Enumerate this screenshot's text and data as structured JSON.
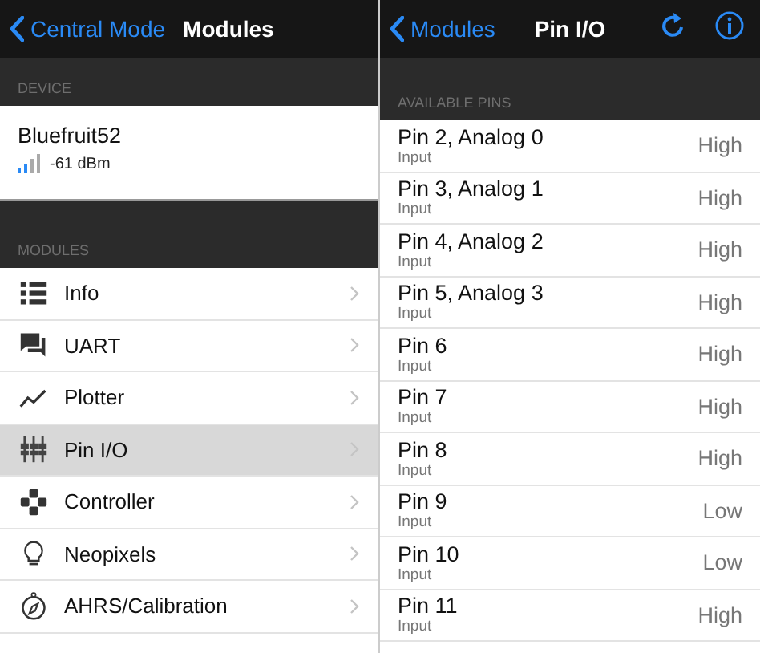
{
  "left": {
    "nav": {
      "back": "Central Mode",
      "title": "Modules"
    },
    "device_header": "DEVICE",
    "device": {
      "name": "Bluefruit52",
      "rssi": "-61 dBm"
    },
    "modules_header": "MODULES",
    "modules": [
      {
        "label": "Info",
        "selected": false
      },
      {
        "label": "UART",
        "selected": false
      },
      {
        "label": "Plotter",
        "selected": false
      },
      {
        "label": "Pin I/O",
        "selected": true
      },
      {
        "label": "Controller",
        "selected": false
      },
      {
        "label": "Neopixels",
        "selected": false
      },
      {
        "label": "AHRS/Calibration",
        "selected": false
      }
    ]
  },
  "right": {
    "nav": {
      "back": "Modules",
      "title": "Pin I/O"
    },
    "pins_header": "AVAILABLE PINS",
    "pins": [
      {
        "name": "Pin 2, Analog 0",
        "mode": "Input",
        "value": "High"
      },
      {
        "name": "Pin 3, Analog 1",
        "mode": "Input",
        "value": "High"
      },
      {
        "name": "Pin 4, Analog 2",
        "mode": "Input",
        "value": "High"
      },
      {
        "name": "Pin 5, Analog 3",
        "mode": "Input",
        "value": "High"
      },
      {
        "name": "Pin 6",
        "mode": "Input",
        "value": "High"
      },
      {
        "name": "Pin 7",
        "mode": "Input",
        "value": "High"
      },
      {
        "name": "Pin 8",
        "mode": "Input",
        "value": "High"
      },
      {
        "name": "Pin 9",
        "mode": "Input",
        "value": "Low"
      },
      {
        "name": "Pin 10",
        "mode": "Input",
        "value": "Low"
      },
      {
        "name": "Pin 11",
        "mode": "Input",
        "value": "High"
      }
    ]
  }
}
